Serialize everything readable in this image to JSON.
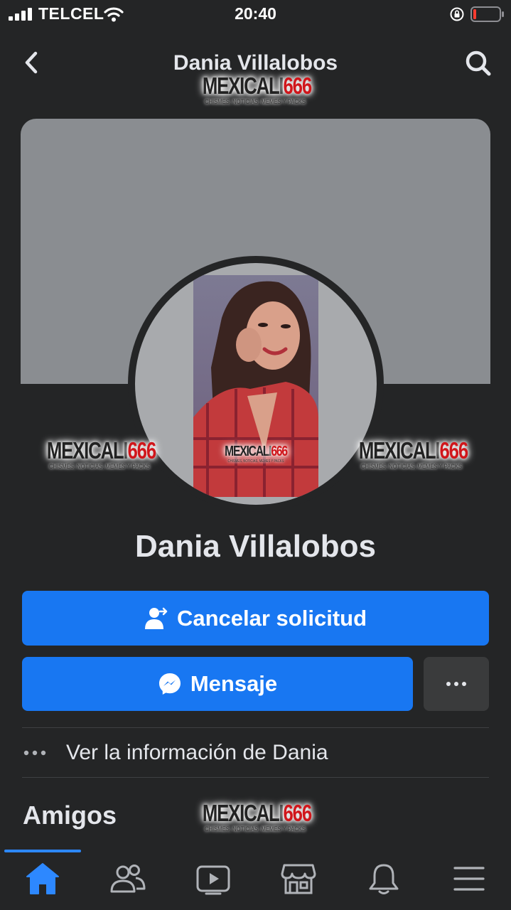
{
  "status_bar": {
    "carrier": "TELCEL",
    "time": "20:40"
  },
  "nav": {
    "title": "Dania Villalobos"
  },
  "watermark": {
    "part1": "MEXICALI",
    "part2": "666",
    "tagline": "CHISMES, NOTICIAS, MEMES Y PACKS"
  },
  "profile": {
    "name": "Dania Villalobos"
  },
  "actions": {
    "cancel_request_label": "Cancelar solicitud",
    "message_label": "Mensaje"
  },
  "info": {
    "text": "Ver la información de Dania"
  },
  "friends": {
    "title": "Amigos"
  },
  "icons": {
    "back": "chevron-left-icon",
    "search": "search-icon",
    "cancel_request": "person-arrow-icon",
    "messenger": "messenger-icon",
    "more": "ellipsis-icon",
    "tabs": [
      "home-icon",
      "friends-icon",
      "watch-icon",
      "marketplace-icon",
      "notifications-icon",
      "menu-icon"
    ]
  },
  "colors": {
    "background": "#242526",
    "accent": "#1877f2",
    "secondary_button": "#3a3b3c",
    "cover": "#8a8d91",
    "text": "#e4e6eb"
  }
}
